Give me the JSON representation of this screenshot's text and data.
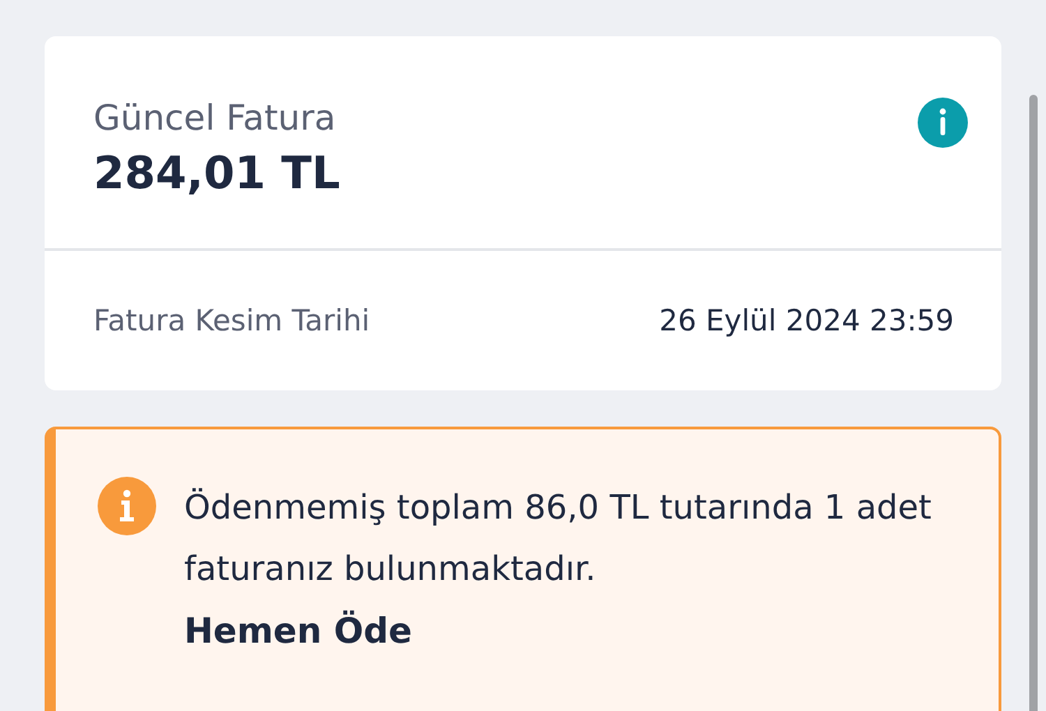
{
  "invoice_card": {
    "title": "Güncel Fatura",
    "amount": "284,01 TL",
    "detail_label": "Fatura Kesim Tarihi",
    "detail_value": "26 Eylül 2024 23:59"
  },
  "alert": {
    "message": "Ödenmemiş toplam 86,0 TL tutarında 1 adet faturanız bulunmaktadır.",
    "action": "Hemen Öde"
  }
}
